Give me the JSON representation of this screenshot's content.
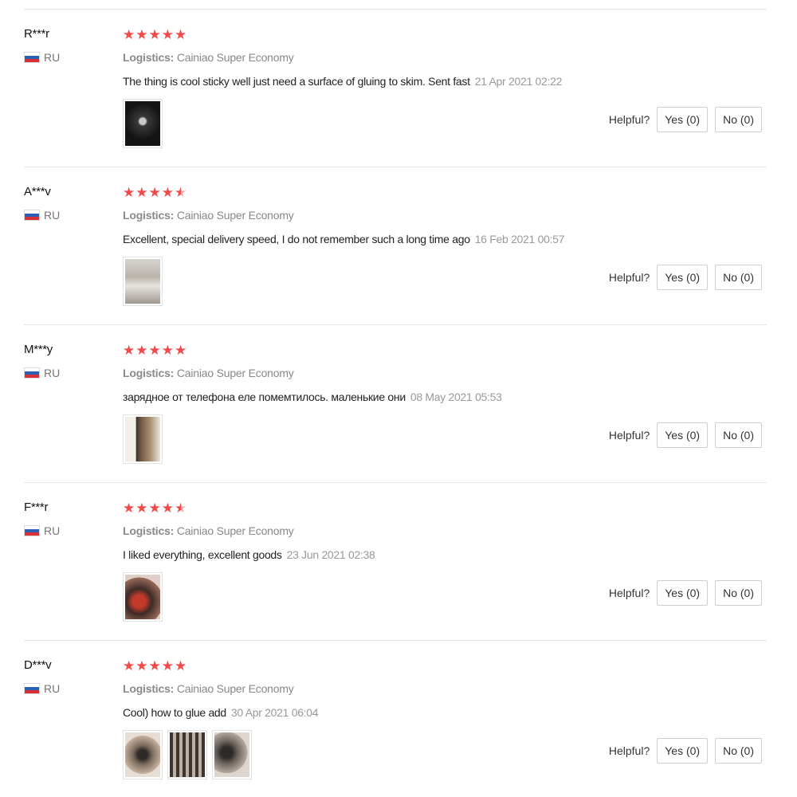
{
  "helpful_label": "Helpful?",
  "logistics_label": "Logistics:",
  "reviews": [
    {
      "username": "R***r",
      "country": "RU",
      "stars": 5,
      "logistics": "Cainiao Super Economy",
      "text": "The thing is cool sticky well just need a surface of gluing to skim. Sent fast",
      "date": "21 Apr 2021 02:22",
      "photos": 1,
      "yes_label": "Yes (0)",
      "no_label": "No (0)"
    },
    {
      "username": "A***v",
      "country": "RU",
      "stars": 4.5,
      "logistics": "Cainiao Super Economy",
      "text": "Excellent, special delivery speed, I do not remember such a long time ago",
      "date": "16 Feb 2021 00:57",
      "photos": 1,
      "yes_label": "Yes (0)",
      "no_label": "No (0)"
    },
    {
      "username": "M***y",
      "country": "RU",
      "stars": 5,
      "logistics": "Cainiao Super Economy",
      "text": "зарядное от телефона еле помемтилось. маленькие они",
      "date": "08 May 2021 05:53",
      "photos": 1,
      "yes_label": "Yes (0)",
      "no_label": "No (0)"
    },
    {
      "username": "F***r",
      "country": "RU",
      "stars": 4.5,
      "logistics": "Cainiao Super Economy",
      "text": "I liked everything, excellent goods",
      "date": "23 Jun 2021 02:38",
      "photos": 1,
      "yes_label": "Yes (0)",
      "no_label": "No (0)"
    },
    {
      "username": "D***v",
      "country": "RU",
      "stars": 5,
      "logistics": "Cainiao Super Economy",
      "text": "Cool) how to glue add",
      "date": "30 Apr 2021 06:04",
      "photos": 3,
      "yes_label": "Yes (0)",
      "no_label": "No (0)"
    }
  ],
  "colors": {
    "star": "#f04a4a",
    "border": "#e8e8e8"
  }
}
